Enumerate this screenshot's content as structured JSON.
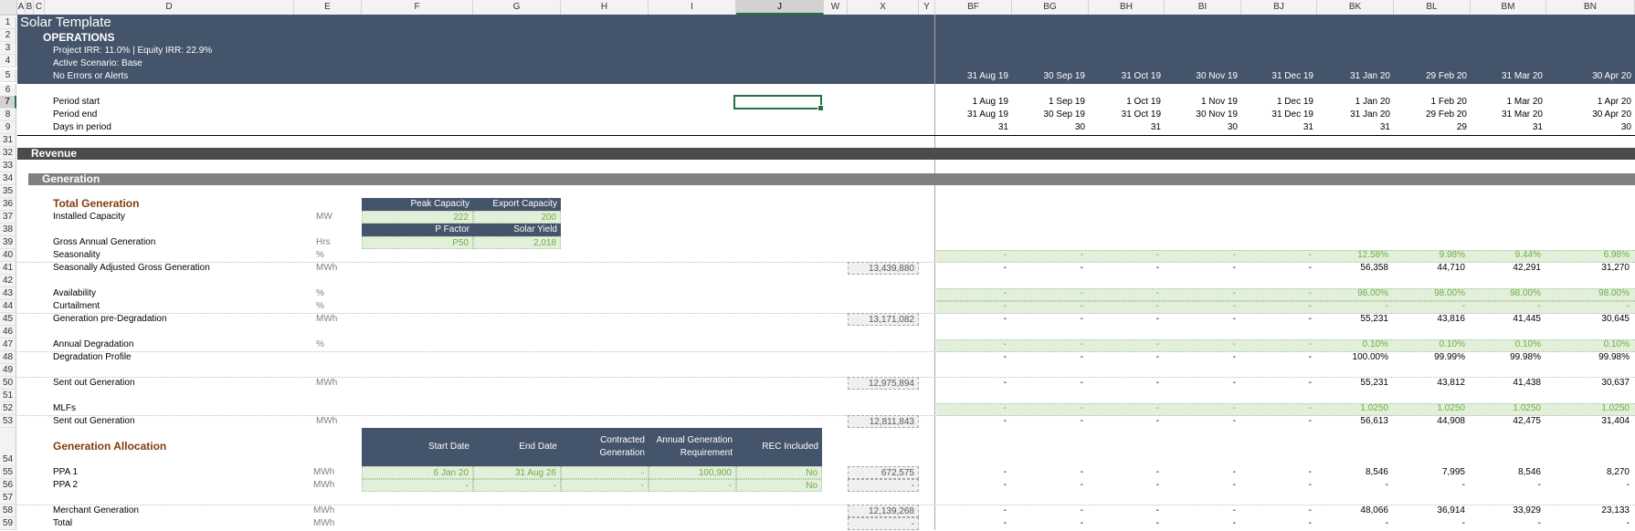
{
  "sheet": {
    "title": "Solar Template",
    "section": "OPERATIONS",
    "irr_line": "Project IRR: 11.0% | Equity IRR: 22.9%",
    "scenario_line": "Active Scenario: Base",
    "alerts_line": "No Errors or Alerts"
  },
  "column_headers": [
    "A",
    "B",
    "C",
    "D",
    "E",
    "F",
    "G",
    "H",
    "I",
    "J",
    "W",
    "X",
    "Y",
    "BF",
    "BG",
    "BH",
    "BI",
    "BJ",
    "BK",
    "BL",
    "BM",
    "BN"
  ],
  "row_numbers": [
    "1",
    "2",
    "3",
    "4",
    "5",
    "6",
    "7",
    "8",
    "9",
    "31",
    "32",
    "33",
    "34",
    "35",
    "36",
    "37",
    "38",
    "39",
    "40",
    "41",
    "42",
    "43",
    "44",
    "45",
    "46",
    "47",
    "48",
    "49",
    "50",
    "51",
    "52",
    "53",
    "54",
    "55",
    "56",
    "57",
    "58",
    "59"
  ],
  "timeline": {
    "period_start_label": "Period start",
    "period_end_label": "Period end",
    "days_label": "Days in period",
    "header_dates": [
      "31 Aug 19",
      "30 Sep 19",
      "31 Oct 19",
      "30 Nov 19",
      "31 Dec 19",
      "31 Jan 20",
      "29 Feb 20",
      "31 Mar 20",
      "30 Apr 20"
    ],
    "period_start": [
      "1 Aug 19",
      "1 Sep 19",
      "1 Oct 19",
      "1 Nov 19",
      "1 Dec 19",
      "1 Jan 20",
      "1 Feb 20",
      "1 Mar 20",
      "1 Apr 20"
    ],
    "period_end": [
      "31 Aug 19",
      "30 Sep 19",
      "31 Oct 19",
      "30 Nov 19",
      "31 Dec 19",
      "31 Jan 20",
      "29 Feb 20",
      "31 Mar 20",
      "30 Apr 20"
    ],
    "days": [
      "31",
      "30",
      "31",
      "30",
      "31",
      "31",
      "29",
      "31",
      "30"
    ]
  },
  "bands": {
    "revenue": "Revenue",
    "generation": "Generation"
  },
  "total_generation": {
    "heading": "Total Generation",
    "installed_capacity_label": "Installed Capacity",
    "installed_unit": "MW",
    "peak_capacity_header": "Peak Capacity",
    "export_capacity_header": "Export Capacity",
    "peak_capacity": "222",
    "export_capacity": "200",
    "p_factor_header": "P Factor",
    "solar_yield_header": "Solar Yield",
    "p_factor": "P50",
    "solar_yield": "2,018",
    "gross_label": "Gross Annual Generation",
    "gross_unit": "Hrs"
  },
  "rows": {
    "seasonality": {
      "label": "Seasonality",
      "unit": "%",
      "total": "",
      "values": [
        "-",
        "-",
        "-",
        "-",
        "-",
        "12.58%",
        "9.98%",
        "9.44%",
        "6.98%"
      ]
    },
    "seasonally_adj": {
      "label": "Seasonally Adjusted Gross Generation",
      "unit": "MWh",
      "total": "13,439,880",
      "values": [
        "-",
        "-",
        "-",
        "-",
        "-",
        "56,358",
        "44,710",
        "42,291",
        "31,270"
      ]
    },
    "availability": {
      "label": "Availability",
      "unit": "%",
      "total": "",
      "values": [
        "-",
        "-",
        "-",
        "-",
        "-",
        "98.00%",
        "98.00%",
        "98.00%",
        "98.00%"
      ]
    },
    "curtailment": {
      "label": "Curtailment",
      "unit": "%",
      "total": "",
      "values": [
        "-",
        "-",
        "-",
        "-",
        "-",
        "-",
        "-",
        "-",
        "-"
      ]
    },
    "gen_pre_deg": {
      "label": "Generation pre-Degradation",
      "unit": "MWh",
      "total": "13,171,082",
      "values": [
        "-",
        "-",
        "-",
        "-",
        "-",
        "55,231",
        "43,816",
        "41,445",
        "30,645"
      ]
    },
    "annual_deg": {
      "label": "Annual Degradation",
      "unit": "%",
      "total": "",
      "values": [
        "-",
        "-",
        "-",
        "-",
        "-",
        "0.10%",
        "0.10%",
        "0.10%",
        "0.10%"
      ]
    },
    "deg_profile": {
      "label": "Degradation Profile",
      "unit": "",
      "total": "",
      "values": [
        "-",
        "-",
        "-",
        "-",
        "-",
        "100.00%",
        "99.99%",
        "99.98%",
        "99.98%"
      ]
    },
    "sent_out_1": {
      "label": "Sent out Generation",
      "unit": "MWh",
      "total": "12,975,894",
      "values": [
        "-",
        "-",
        "-",
        "-",
        "-",
        "55,231",
        "43,812",
        "41,438",
        "30,637"
      ]
    },
    "mlfs": {
      "label": "MLFs",
      "unit": "",
      "total": "",
      "values": [
        "-",
        "-",
        "-",
        "-",
        "-",
        "1.0250",
        "1.0250",
        "1.0250",
        "1.0250"
      ]
    },
    "sent_out_2": {
      "label": "Sent out Generation",
      "unit": "MWh",
      "total": "12,811,843",
      "values": [
        "-",
        "-",
        "-",
        "-",
        "-",
        "56,613",
        "44,908",
        "42,475",
        "31,404"
      ]
    }
  },
  "allocation": {
    "heading": "Generation Allocation",
    "headers": {
      "start": "Start Date",
      "end": "End Date",
      "contracted_1": "Contracted",
      "contracted_2": "Generation",
      "annual_1": "Annual Generation",
      "annual_2": "Requirement",
      "rec": "REC Included"
    },
    "ppa1": {
      "label": "PPA 1",
      "unit": "MWh",
      "start": "6 Jan 20",
      "end": "31 Aug 26",
      "contracted": "-",
      "annual": "100,900",
      "rec": "No",
      "total": "672,575",
      "values": [
        "-",
        "-",
        "-",
        "-",
        "-",
        "8,546",
        "7,995",
        "8,546",
        "8,270"
      ]
    },
    "ppa2": {
      "label": "PPA 2",
      "unit": "MWh",
      "start": "-",
      "end": "-",
      "contracted": "-",
      "annual": "-",
      "rec": "No",
      "total": "-",
      "values": [
        "-",
        "-",
        "-",
        "-",
        "-",
        "-",
        "-",
        "-",
        "-"
      ]
    },
    "merchant": {
      "label": "Merchant Generation",
      "unit": "MWh",
      "total": "12,139,268",
      "values": [
        "-",
        "-",
        "-",
        "-",
        "-",
        "48,066",
        "36,914",
        "33,929",
        "23,133"
      ]
    },
    "total": {
      "label": "Total",
      "unit": "MWh",
      "total": "-",
      "values": [
        "-",
        "-",
        "-",
        "-",
        "-",
        "-",
        "-",
        "-",
        "-"
      ]
    }
  }
}
